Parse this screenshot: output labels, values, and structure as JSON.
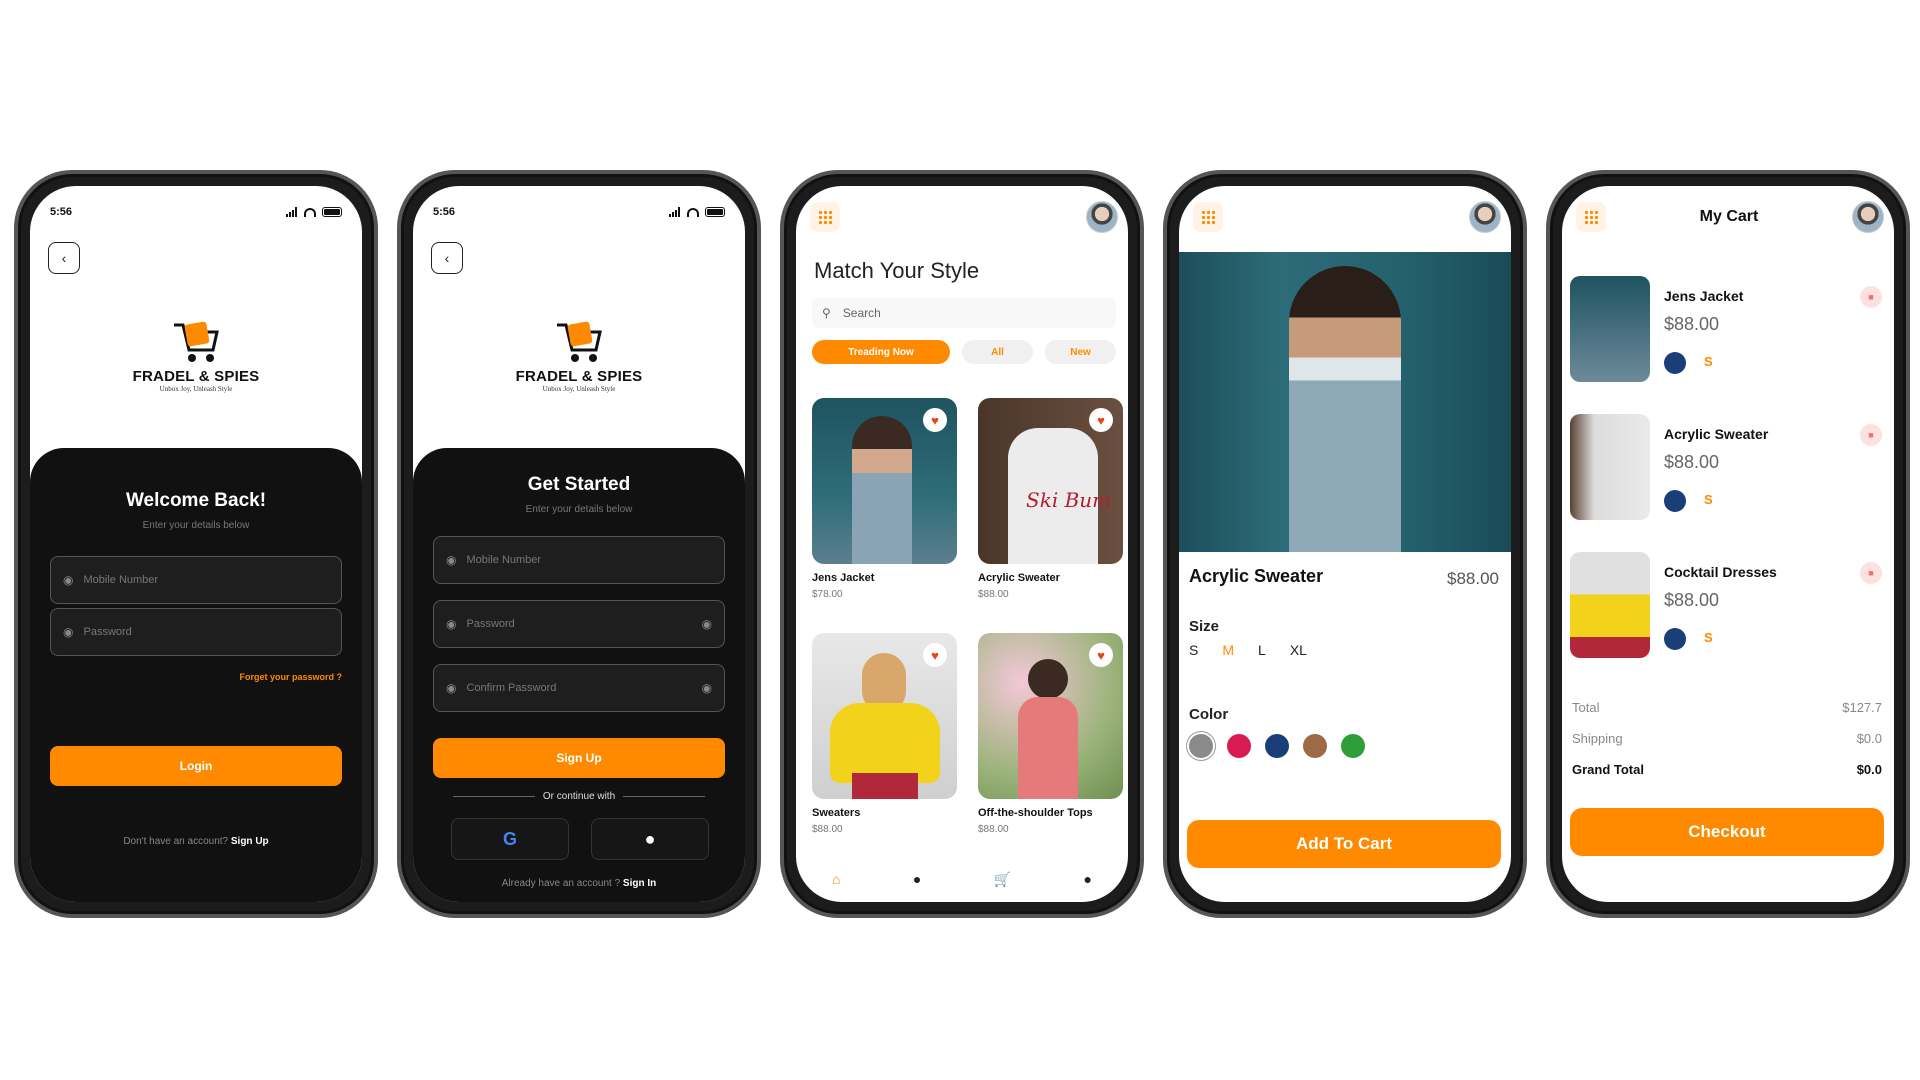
{
  "brand": {
    "name": "FRADEL & SPIES",
    "tagline": "Unbox Joy, Unleash Style"
  },
  "status": {
    "time": "5:56"
  },
  "login": {
    "title": "Welcome Back!",
    "subtitle": "Enter your details below",
    "mobile_placeholder": "Mobile Number",
    "password_placeholder": "Password",
    "forgot": "Forget your password ?",
    "button": "Login",
    "footer_text": "Don't have an account?",
    "footer_link": "Sign Up"
  },
  "signup": {
    "title": "Get Started",
    "subtitle": "Enter your details below",
    "mobile_placeholder": "Mobile Number",
    "password_placeholder": "Password",
    "confirm_placeholder": "Confirm Password",
    "button": "Sign Up",
    "or_continue": "Or continue with",
    "footer_text": "Already have an account ?",
    "footer_link": "Sign In"
  },
  "home": {
    "title": "Match Your Style",
    "search_placeholder": "Search",
    "chips": [
      "Treading Now",
      "All",
      "New"
    ],
    "products": [
      {
        "name": "Jens Jacket",
        "price": "$78.00"
      },
      {
        "name": "Acrylic Sweater",
        "price": "$88.00"
      },
      {
        "name": "Sweaters",
        "price": "$88.00"
      },
      {
        "name": "Off-the-shoulder Tops",
        "price": "$88.00"
      }
    ]
  },
  "detail": {
    "name": "Acrylic Sweater",
    "price": "$88.00",
    "size_label": "Size",
    "sizes": [
      "S",
      "M",
      "L",
      "XL"
    ],
    "selected_size": "M",
    "color_label": "Color",
    "colors": [
      "#8a8a8a",
      "#d81b50",
      "#1a3e78",
      "#9c6a44",
      "#2e9e3a"
    ],
    "button": "Add To Cart"
  },
  "cart": {
    "title": "My Cart",
    "items": [
      {
        "name": "Jens Jacket",
        "price": "$88.00",
        "size": "S"
      },
      {
        "name": "Acrylic Sweater",
        "price": "$88.00",
        "size": "S"
      },
      {
        "name": "Cocktail Dresses",
        "price": "$88.00",
        "size": "S"
      }
    ],
    "summary": [
      {
        "label": "Total",
        "value": "$127.7"
      },
      {
        "label": "Shipping",
        "value": "$0.0"
      },
      {
        "label": "Grand Total",
        "value": "$0.0"
      }
    ],
    "button": "Checkout"
  },
  "colors": {
    "accent": "#ff8a00",
    "dark": "#111111"
  }
}
